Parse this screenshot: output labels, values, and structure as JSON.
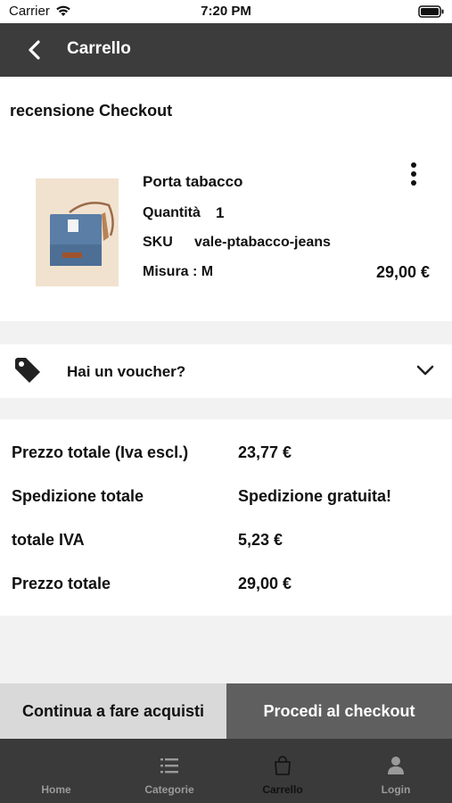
{
  "status_bar": {
    "carrier": "Carrier",
    "time": "7:20 PM"
  },
  "nav": {
    "title": "Carrello"
  },
  "section": {
    "title": "recensione Checkout"
  },
  "product": {
    "name": "Porta tabacco",
    "quantity_label": "Quantità",
    "quantity": "1",
    "sku_label": "SKU",
    "sku": "vale-ptabacco-jeans",
    "size": "Misura : M",
    "price": "29,00 €"
  },
  "voucher": {
    "label": "Hai un voucher?"
  },
  "totals": [
    {
      "label": "Prezzo totale (Iva escl.)",
      "value": "23,77 €"
    },
    {
      "label": "Spedizione totale",
      "value": "Spedizione gratuita!"
    },
    {
      "label": "totale IVA",
      "value": "5,23 €"
    },
    {
      "label": "Prezzo totale",
      "value": "29,00 €"
    }
  ],
  "actions": {
    "continue": "Continua a fare acquisti",
    "checkout": "Procedi al checkout"
  },
  "tabs": [
    {
      "label": "Home",
      "icon": "home-icon"
    },
    {
      "label": "Categorie",
      "icon": "list-icon"
    },
    {
      "label": "Carrello",
      "icon": "bag-icon"
    },
    {
      "label": "Login",
      "icon": "user-icon"
    }
  ],
  "colors": {
    "nav_bg": "#3c3c3c",
    "checkout_bg": "#5f5f5f",
    "continue_bg": "#d9d9d9",
    "tab_bg": "#3a3a3a"
  }
}
